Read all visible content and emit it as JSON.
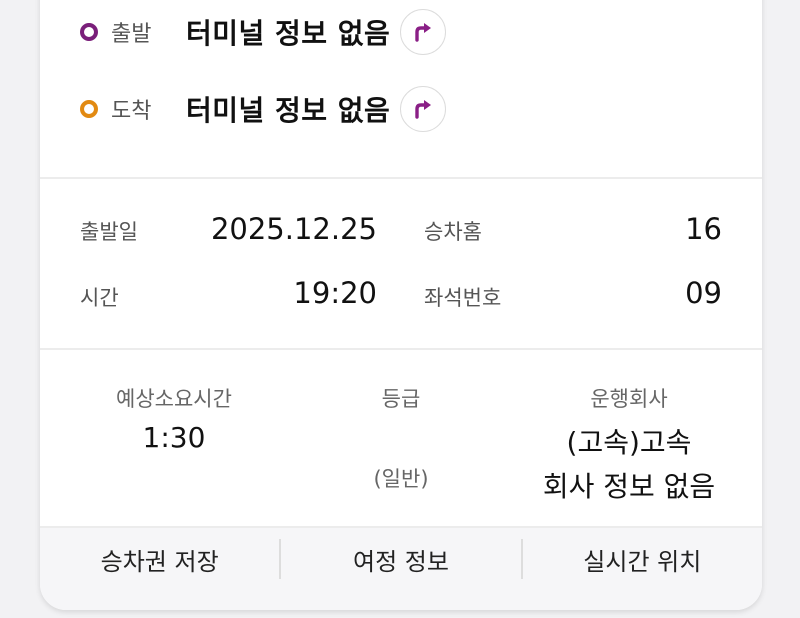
{
  "route": {
    "departure": {
      "label": "출발",
      "value": "터미널 정보 없음",
      "dot_color": "#7a1f7a"
    },
    "arrival": {
      "label": "도착",
      "value": "터미널 정보 없음",
      "dot_color": "#e28a12"
    },
    "button_icon": "turn-right-arrow-icon",
    "icon_color": "#8a1f86"
  },
  "ticket": {
    "date_label": "출발일",
    "date_value": "2025.12.25",
    "platform_label": "승차홈",
    "platform_value": "16",
    "time_label": "시간",
    "time_value": "19:20",
    "seat_label": "좌석번호",
    "seat_value": "09"
  },
  "summary": {
    "duration_label": "예상소요시간",
    "duration_value": "1:30",
    "grade_label": "등급",
    "grade_value": "(일반)",
    "company_label": "운행회사",
    "company_value1": "(고속)고속",
    "company_value2": "회사 정보 없음"
  },
  "actions": {
    "save_ticket": "승차권 저장",
    "trip_info": "여정 정보",
    "realtime_location": "실시간 위치"
  }
}
